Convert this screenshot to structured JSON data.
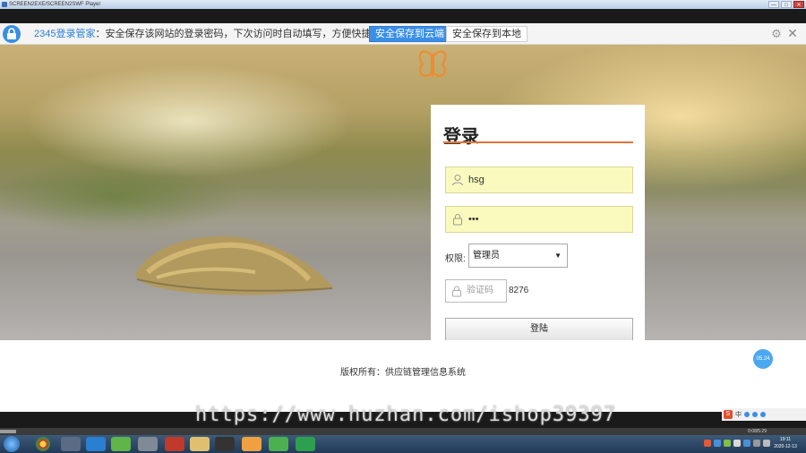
{
  "window": {
    "title": "SCREEN2EXE/SCREEN2SWF Player",
    "buttons": [
      "—",
      "□",
      "✕"
    ]
  },
  "password_manager": {
    "brand": "2345登录管家",
    "message": "：安全保存该网站的登录密码，下次访问时自动填写，方便快捷。",
    "save_cloud_label": "安全保存到云端",
    "save_local_label": "安全保存到本地",
    "gear_icon": "gear-icon",
    "close_icon": "close-icon",
    "accent": "#3a8ee6"
  },
  "login": {
    "title": "登录",
    "username_value": "hsg",
    "password_value": "•••",
    "role_label": "权限:",
    "role_selected": "管理员",
    "captcha_placeholder": "验证码",
    "captcha_code": "8276",
    "submit_label": "登陆",
    "accent": "#e8743b"
  },
  "footer": {
    "copyright": "版权所有：供应链管理信息系统",
    "badge": "05.24"
  },
  "watermark": "https://www.huzhan.com/ishop39397",
  "ime": {
    "logo": "S",
    "mode": "中"
  },
  "player": {
    "timecode": "0:08/5:29",
    "progress": 0.02
  },
  "taskbar": {
    "clock_time": "19:11",
    "clock_date": "2020-12-13"
  }
}
